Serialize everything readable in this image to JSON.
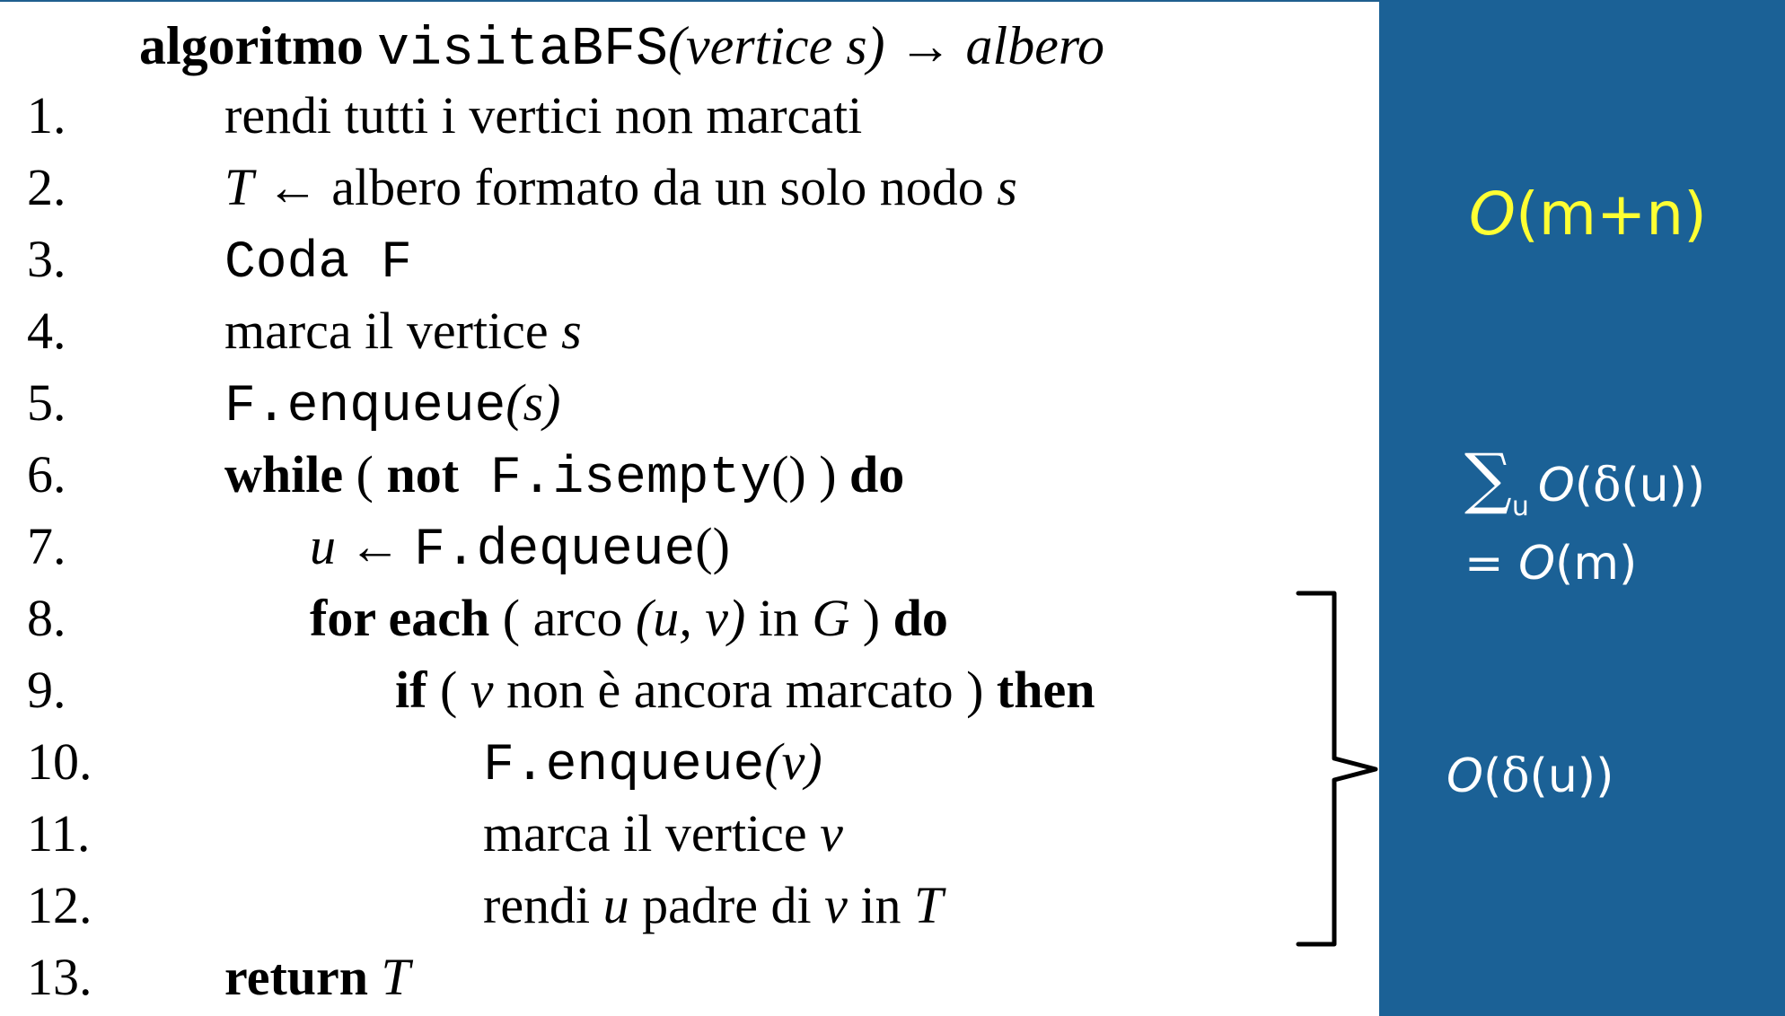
{
  "header": {
    "keyword": "algoritmo",
    "name": "visitaBFS",
    "param": "(vertice s)",
    "arrow": "→",
    "return_type": "albero"
  },
  "lines": [
    {
      "n": "1.",
      "text": "rendi tutti i vertici non marcati"
    },
    {
      "n": "2.",
      "T": "T",
      "arrow": "←",
      "text": " albero formato da un solo nodo ",
      "s": "s"
    },
    {
      "n": "3.",
      "code": "Coda F"
    },
    {
      "n": "4.",
      "text": "marca il vertice ",
      "s": "s"
    },
    {
      "n": "5.",
      "code": "F.enqueue",
      "arg": "(s)"
    },
    {
      "n": "6.",
      "kw1": "while",
      "p1": " ( ",
      "kw2": "not",
      "code": " F.isempty",
      "p2": "() ) ",
      "kw3": "do"
    },
    {
      "n": "7.",
      "u": "u",
      "arrow": " ← ",
      "code": "F.dequeue",
      "p": "()"
    },
    {
      "n": "8.",
      "kw1": "for each",
      "t1": " ( arco ",
      "e": "(u, v)",
      "t2": " in ",
      "G": "G",
      "t3": " ) ",
      "kw2": "do"
    },
    {
      "n": "9.",
      "kw1": "if",
      "t1": " ( ",
      "v": "v",
      "t2": " non è ancora marcato ) ",
      "kw2": "then"
    },
    {
      "n": "10.",
      "code": "F.enqueue",
      "arg": "(v)"
    },
    {
      "n": "11.",
      "text": "marca il vertice ",
      "v": "v"
    },
    {
      "n": "12.",
      "t1": "rendi ",
      "u": "u",
      "t2": " padre di ",
      "v": "v",
      "t3": " in ",
      "T": "T"
    },
    {
      "n": "13.",
      "kw": "return",
      "T": " T"
    }
  ],
  "annotations": {
    "total": {
      "O": "O",
      "rest": "(m+n)"
    },
    "sum": {
      "sigma": "∑",
      "sub": "u",
      "O": "O",
      "open": "(",
      "delta": "δ",
      "rest": "(u))"
    },
    "equals": {
      "eq": "= ",
      "O": "O",
      "rest": "(m)"
    },
    "inner": {
      "O": "O",
      "open": "(",
      "delta": "δ",
      "rest": "(u))"
    }
  },
  "colors": {
    "panel": "#1b6196",
    "highlight": "#ffff33",
    "annotation": "#ffffff"
  }
}
